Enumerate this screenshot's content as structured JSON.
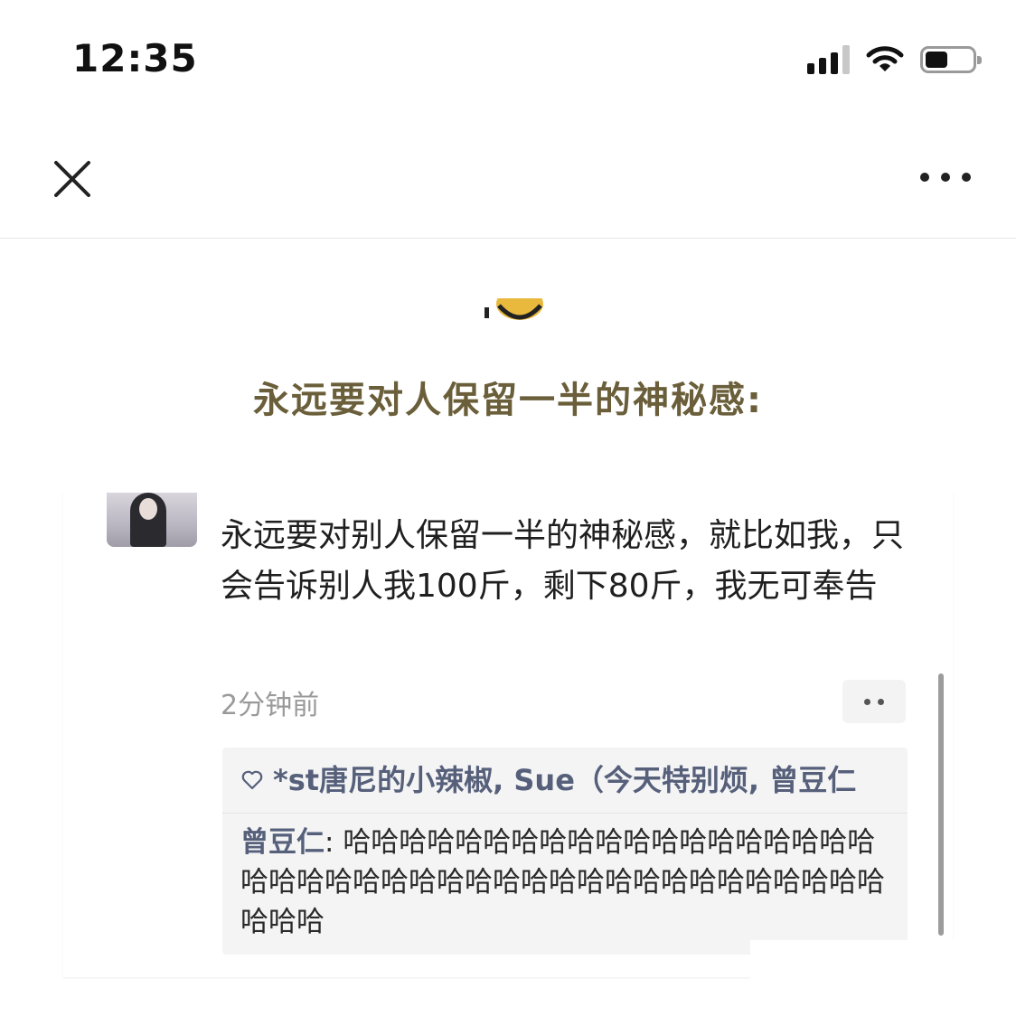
{
  "status_bar": {
    "time": "12:35",
    "icons": [
      "cellular-signal-icon",
      "wifi-icon",
      "battery-icon"
    ]
  },
  "nav_bar": {
    "close_icon": "close-icon",
    "more_icon": "more-icon"
  },
  "article": {
    "headline": "永远要对人保留一半的神秘感:"
  },
  "embedded_post": {
    "text": "永远要对别人保留一半的神秘感，就比如我，只会告诉别人我100斤，剩下80斤，我无可奉告",
    "time": "2分钟前",
    "likes": "*st唐尼的小辣椒, Sue（今天特别烦, 曾豆仁",
    "comment": {
      "author": "曾豆仁",
      "text": "哈哈哈哈哈哈哈哈哈哈哈哈哈哈哈哈哈哈哈哈哈哈哈哈哈哈哈哈哈哈哈哈哈哈哈哈哈哈哈哈哈哈哈哈哈"
    }
  },
  "colors": {
    "headline": "#6a5f3a",
    "link_name": "#56607a",
    "muted": "#9a9a9a"
  }
}
